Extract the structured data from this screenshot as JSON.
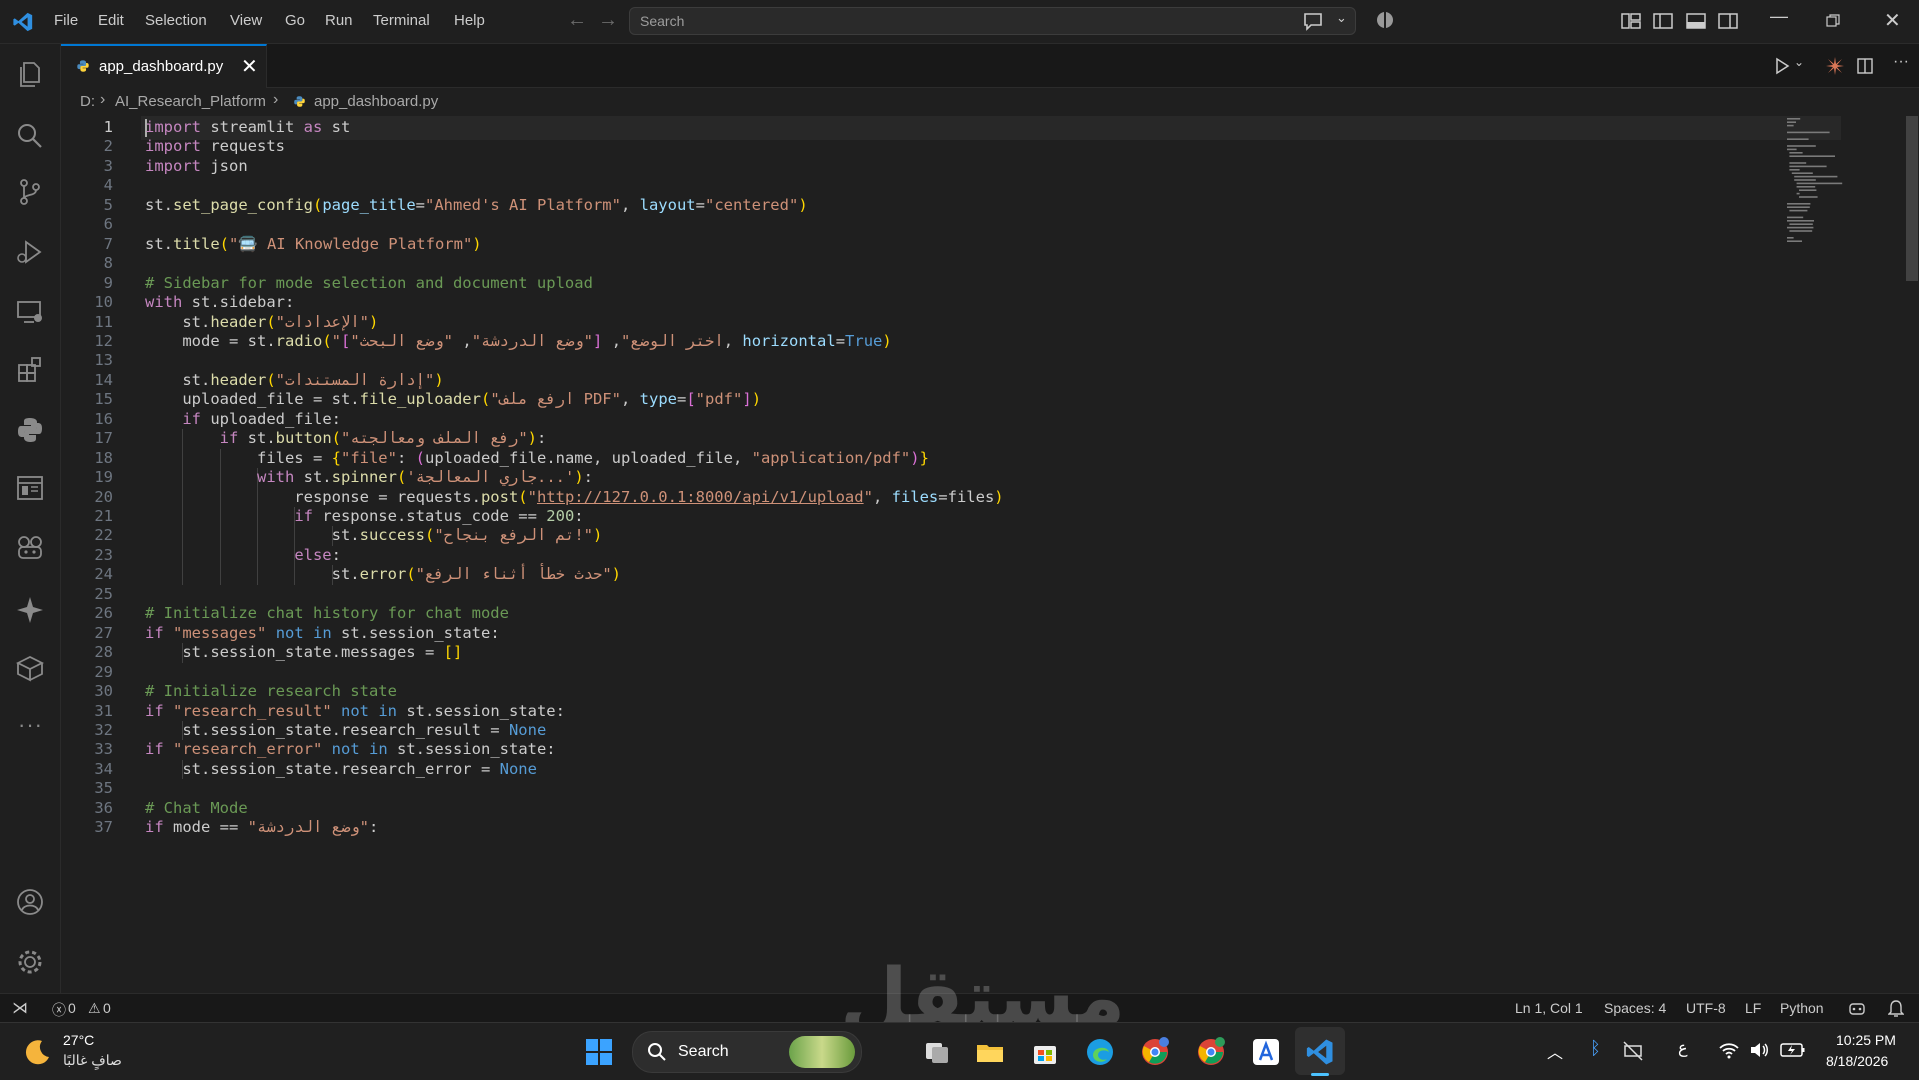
{
  "menu": [
    "File",
    "Edit",
    "Selection",
    "View",
    "Go",
    "Run",
    "Terminal",
    "Help"
  ],
  "search": {
    "placeholder": "Search"
  },
  "tab": {
    "filename": "app_dashboard.py"
  },
  "breadcrumb": {
    "drive": "D:",
    "folder": "AI_Research_Platform",
    "file": "app_dashboard.py"
  },
  "editor": {
    "lines": [
      {
        "n": "1",
        "html": "<span class='kw'>import</span> streamlit <span class='kw'>as</span> st"
      },
      {
        "n": "2",
        "html": "<span class='kw'>import</span> requests"
      },
      {
        "n": "3",
        "html": "<span class='kw'>import</span> json"
      },
      {
        "n": "4",
        "html": ""
      },
      {
        "n": "5",
        "html": "st.<span class='fn'>set_page_config</span><span class='br'>(</span><span class='par'>page_title</span>=<span class='str'>\"Ahmed's AI Platform\"</span>, <span class='par'>layout</span>=<span class='str'>\"centered\"</span><span class='br'>)</span>"
      },
      {
        "n": "6",
        "html": ""
      },
      {
        "n": "7",
        "html": "st.<span class='fn'>title</span><span class='br'>(</span><span class='str'>\"🚍 AI Knowledge Platform\"</span><span class='br'>)</span>"
      },
      {
        "n": "8",
        "html": ""
      },
      {
        "n": "9",
        "html": "<span class='cm'># Sidebar for mode selection and document upload</span>"
      },
      {
        "n": "10",
        "html": "<span class='kw'>with</span> st.sidebar:"
      },
      {
        "n": "11",
        "html": "    st.<span class='fn'>header</span><span class='br'>(</span><span class='str'>\"الإعدادات\"</span><span class='br'>)</span>"
      },
      {
        "n": "12",
        "html": "    mode = st.<span class='fn'>radio</span><span class='br'>(</span><span class='str'>\"اختر الوضع\"</span>, <span class='br2'>[</span><span class='str'>\"وضع الدردشة\"</span>, <span class='str'>\"وضع البحث\"</span><span class='br2'>]</span>, <span class='par'>horizontal</span>=<span class='kb'>True</span><span class='br'>)</span>"
      },
      {
        "n": "13",
        "html": ""
      },
      {
        "n": "14",
        "html": "    st.<span class='fn'>header</span><span class='br'>(</span><span class='str'>\"إدارة المستندات\"</span><span class='br'>)</span>"
      },
      {
        "n": "15",
        "html": "    uploaded_file = st.<span class='fn'>file_uploader</span><span class='br'>(</span><span class='str'>\"ارفع ملف PDF\"</span>, <span class='par'>type</span>=<span class='br2'>[</span><span class='str'>\"pdf\"</span><span class='br2'>]</span><span class='br'>)</span>"
      },
      {
        "n": "16",
        "html": "    <span class='kw'>if</span> uploaded_file:"
      },
      {
        "n": "17",
        "html": "        <span class='kw'>if</span> st.<span class='fn'>button</span><span class='br'>(</span><span class='str'>\"رفع الملف ومعالجته\"</span><span class='br'>)</span>:"
      },
      {
        "n": "18",
        "html": "            files = <span class='br'>{</span><span class='str'>\"file\"</span>: <span class='br2'>(</span>uploaded_file.name, uploaded_file, <span class='str'>\"application/pdf\"</span><span class='br2'>)</span><span class='br'>}</span>"
      },
      {
        "n": "19",
        "html": "            <span class='kw'>with</span> st.<span class='fn'>spinner</span><span class='br'>(</span><span class='str'>'جاري المعالجة...'</span><span class='br'>)</span>:"
      },
      {
        "n": "20",
        "html": "                response = requests.<span class='fn'>post</span><span class='br'>(</span><span class='str'>\"</span><span class='url'>http://127.0.0.1:8000/api/v1/upload</span><span class='str'>\"</span>, <span class='par'>files</span>=files<span class='br'>)</span>"
      },
      {
        "n": "21",
        "html": "                <span class='kw'>if</span> response.status_code == <span class='num'>200</span>:"
      },
      {
        "n": "22",
        "html": "                    st.<span class='fn'>success</span><span class='br'>(</span><span class='str'>\"تم الرفع بنجاح!\"</span><span class='br'>)</span>"
      },
      {
        "n": "23",
        "html": "                <span class='kw'>else</span>:"
      },
      {
        "n": "24",
        "html": "                    st.<span class='fn'>error</span><span class='br'>(</span><span class='str'>\"حدث خطأ أثناء الرفع\"</span><span class='br'>)</span>"
      },
      {
        "n": "25",
        "html": ""
      },
      {
        "n": "26",
        "html": "<span class='cm'># Initialize chat history for chat mode</span>"
      },
      {
        "n": "27",
        "html": "<span class='kw'>if</span> <span class='str'>\"messages\"</span> <span class='kb'>not in</span> st.session_state:"
      },
      {
        "n": "28",
        "html": "    st.session_state.messages = <span class='br'>[]</span>"
      },
      {
        "n": "29",
        "html": ""
      },
      {
        "n": "30",
        "html": "<span class='cm'># Initialize research state</span>"
      },
      {
        "n": "31",
        "html": "<span class='kw'>if</span> <span class='str'>\"research_result\"</span> <span class='kb'>not in</span> st.session_state:"
      },
      {
        "n": "32",
        "html": "    st.session_state.research_result = <span class='kb'>None</span>"
      },
      {
        "n": "33",
        "html": "<span class='kw'>if</span> <span class='str'>\"research_error\"</span> <span class='kb'>not in</span> st.session_state:"
      },
      {
        "n": "34",
        "html": "    st.session_state.research_error = <span class='kb'>None</span>"
      },
      {
        "n": "35",
        "html": ""
      },
      {
        "n": "36",
        "html": "<span class='cm'># Chat Mode</span>"
      },
      {
        "n": "37",
        "html": "<span class='kw'>if</span> mode == <span class='str'>\"وضع الدردشة\"</span>:"
      }
    ]
  },
  "status": {
    "errors": "0",
    "warnings": "0",
    "cursor": "Ln 1, Col 1",
    "spaces": "Spaces: 4",
    "encoding": "UTF-8",
    "eol": "LF",
    "language": "Python"
  },
  "taskbar": {
    "temp": "27°C",
    "weather": "صافٍ غالبًا",
    "search": "Search",
    "time": "10:25 PM",
    "date": "8/18/2026",
    "lang": "ع"
  },
  "watermark": "مستقل"
}
